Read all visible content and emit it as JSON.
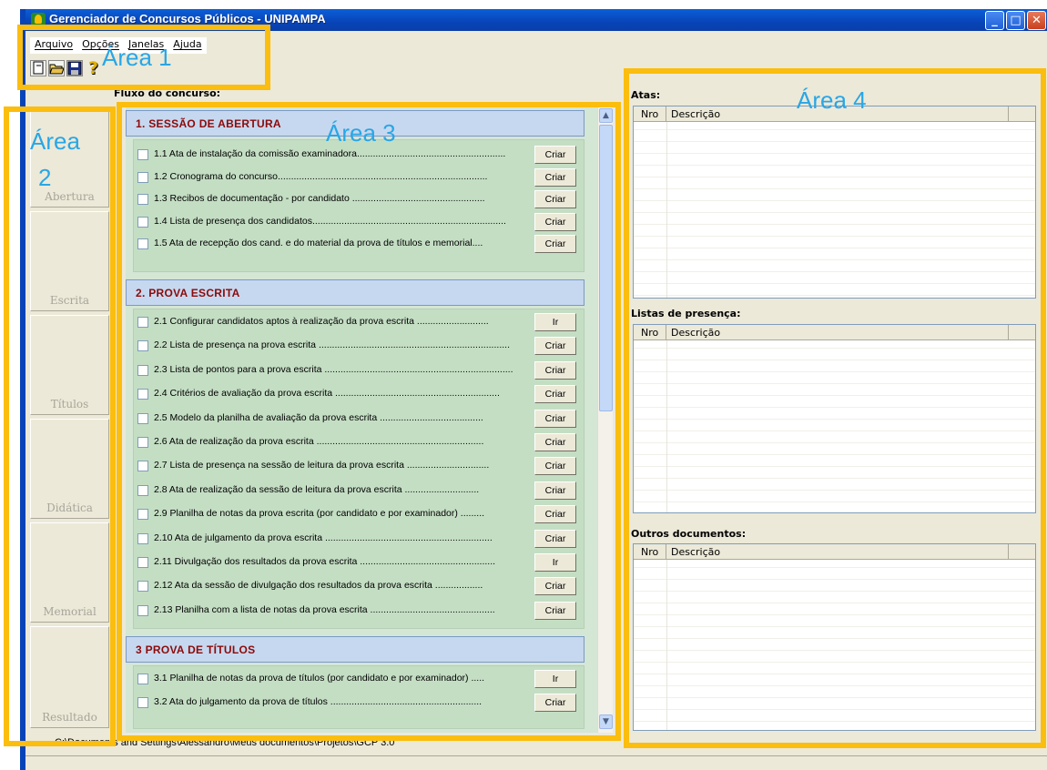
{
  "window": {
    "title": "Gerenciador de Concursos Públicos - UNIPAMPA"
  },
  "menu": {
    "items": [
      "Arquivo",
      "Opções",
      "Janelas",
      "Ajuda"
    ]
  },
  "toolbar": {
    "icons": [
      "new-file-icon",
      "open-folder-icon",
      "save-icon",
      "help-icon"
    ],
    "help_glyph": "?"
  },
  "nav": {
    "items": [
      "Abertura",
      "Escrita",
      "Títulos",
      "Didática",
      "Memorial",
      "Resultado"
    ]
  },
  "flow": {
    "title": "Fluxo do concurso:",
    "sections": [
      {
        "title": "1. SESSÃO DE ABERTURA",
        "items": [
          {
            "label": "1.1 Ata de instalação da comissão examinadora........................................................",
            "action": "Criar"
          },
          {
            "label": "1.2 Cronograma do concurso...............................................................................",
            "action": "Criar"
          },
          {
            "label": "1.3 Recibos de documentação - por candidato ..................................................",
            "action": "Criar"
          },
          {
            "label": "1.4 Lista de presença dos candidatos.........................................................................",
            "action": "Criar"
          },
          {
            "label": "1.5 Ata de recepção dos cand. e do material da prova de títulos e memorial....",
            "action": "Criar"
          }
        ]
      },
      {
        "title": "2. PROVA ESCRITA",
        "items": [
          {
            "label": "2.1 Configurar candidatos aptos à realização da prova escrita ...........................",
            "action": "Ir"
          },
          {
            "label": "2.2 Lista de presença na prova escrita ........................................................................",
            "action": "Criar"
          },
          {
            "label": "2.3 Lista de pontos para a prova escrita .......................................................................",
            "action": "Criar"
          },
          {
            "label": "2.4 Critérios de avaliação da prova escrita ..............................................................",
            "action": "Criar"
          },
          {
            "label": "2.5 Modelo da planilha de avaliação da prova escrita .......................................",
            "action": "Criar"
          },
          {
            "label": "2.6 Ata de realização da prova escrita ...............................................................",
            "action": "Criar"
          },
          {
            "label": "2.7 Lista de presença na sessão de leitura da prova escrita ...............................",
            "action": "Criar"
          },
          {
            "label": "2.8 Ata de realização da sessão de leitura da prova escrita ............................",
            "action": "Criar"
          },
          {
            "label": "2.9 Planilha de notas da prova escrita (por candidato e por examinador) .........",
            "action": "Criar"
          },
          {
            "label": "2.10 Ata de julgamento da prova escrita ...............................................................",
            "action": "Criar"
          },
          {
            "label": "2.11 Divulgação dos resultados da prova escrita ...................................................",
            "action": "Ir"
          },
          {
            "label": "2.12 Ata da sessão de divulgação dos resultados da prova escrita ..................",
            "action": "Criar"
          },
          {
            "label": "2.13 Planilha com a lista de notas da prova escrita ...............................................",
            "action": "Criar"
          }
        ]
      },
      {
        "title": "3  PROVA DE TÍTULOS",
        "items": [
          {
            "label": "3.1 Planilha de notas da prova de títulos (por candidato e por examinador) .....",
            "action": "Ir"
          },
          {
            "label": "3.2 Ata do julgamento da prova de títulos .........................................................",
            "action": "Criar"
          }
        ]
      }
    ]
  },
  "panels": {
    "atas": {
      "title": "Atas:",
      "col_nro": "Nro",
      "col_desc": "Descrição"
    },
    "listas": {
      "title": "Listas de presença:",
      "col_nro": "Nro",
      "col_desc": "Descrição"
    },
    "outros": {
      "title": "Outros documentos:",
      "col_nro": "Nro",
      "col_desc": "Descrição"
    }
  },
  "status": {
    "path": "C:\\Documents and Settings\\Alessandro\\Meus documentos\\Projetos\\GCP 3.0"
  },
  "annotations": {
    "area1": "Área 1",
    "area2_line1": "Área",
    "area2_line2": "2",
    "area3": "Área 3",
    "area4": "Área 4",
    "color": "#fbbd0e",
    "label_color": "#29a6e6"
  }
}
